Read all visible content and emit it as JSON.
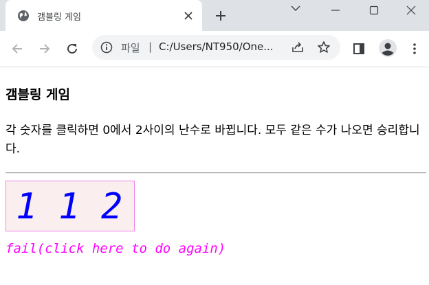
{
  "browser": {
    "tab": {
      "title": "갬블링 게임",
      "favicon": "globe-icon"
    },
    "address": {
      "scheme_label": "파일",
      "separator": "|",
      "url": "C:/Users/NT950/One..."
    },
    "icons": {
      "back": "back-arrow-icon",
      "forward": "forward-arrow-icon",
      "reload": "reload-icon",
      "info": "info-icon",
      "share": "share-icon",
      "bookmark": "star-icon",
      "side_panel": "side-panel-icon",
      "profile": "profile-avatar-icon",
      "menu": "kebab-menu-icon",
      "tab_search": "chevron-down-icon",
      "minimize": "minimize-icon",
      "maximize": "maximize-icon",
      "close": "close-icon",
      "new_tab": "plus-icon"
    }
  },
  "page": {
    "heading": "갬블링 게임",
    "description": "각 숫자를 클릭하면 0에서 2사이의 난수로 바뀝니다. 모두 같은 수가 나오면 승리합니다.",
    "numbers": [
      "1",
      "1",
      "2"
    ],
    "result": "fail(click here to do again)"
  },
  "colors": {
    "number": "#0000ff",
    "result": "#ff00ff",
    "box_background": "#faeeee",
    "box_border": "#ee82ee",
    "titlebar": "#dee1e6",
    "omnibox": "#f1f3f4"
  }
}
